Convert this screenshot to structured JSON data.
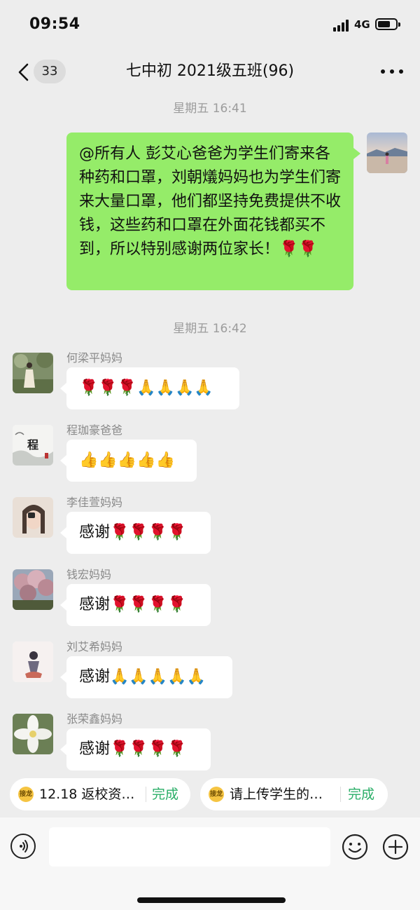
{
  "status": {
    "time": "09:54",
    "network": "4G",
    "battery_level": 0.7
  },
  "nav": {
    "unread_count": "33",
    "title": "七中初 2021级五班(96)"
  },
  "timestamps": [
    "星期五 16:41",
    "星期五 16:42"
  ],
  "sent_message": {
    "text": "@所有人 彭艾心爸爸为学生们寄来各种药和口罩，刘朝燨妈妈也为学生们寄来大量口罩，他们都坚持免费提供不收钱，这些药和口罩在外面花钱都买不到，所以特别感谢两位家长！🌹🌹"
  },
  "messages": [
    {
      "sender": "何梁平妈妈",
      "text": "🌹🌹🌹🙏🙏🙏🙏",
      "avatar": "woman-outdoor-photo"
    },
    {
      "sender": "程珈豪爸爸",
      "text": "👍👍👍👍👍",
      "avatar": "ink-painting-cheng",
      "avatar_char": "程"
    },
    {
      "sender": "李佳萱妈妈",
      "text": "感谢🌹🌹🌹🌹",
      "avatar": "woman-selfie-photo"
    },
    {
      "sender": "钱宏妈妈",
      "text": "感谢🌹🌹🌹🌹",
      "avatar": "blossom-tree-photo"
    },
    {
      "sender": "刘艾希妈妈",
      "text": "感谢🙏🙏🙏🙏🙏",
      "avatar": "figure-illustration"
    },
    {
      "sender": "张荣鑫妈妈",
      "text": "感谢🌹🌹🌹🌹",
      "avatar": "white-flower-photo"
    }
  ],
  "pinned": [
    {
      "icon_label": "接龙",
      "text": "12.18 返校资…",
      "action": "完成"
    },
    {
      "icon_label": "接龙",
      "text": "请上传学生的…",
      "action": "完成"
    }
  ],
  "colors": {
    "sent_bubble": "#95ec69",
    "done_green": "#2aae67",
    "background": "#ededed"
  }
}
